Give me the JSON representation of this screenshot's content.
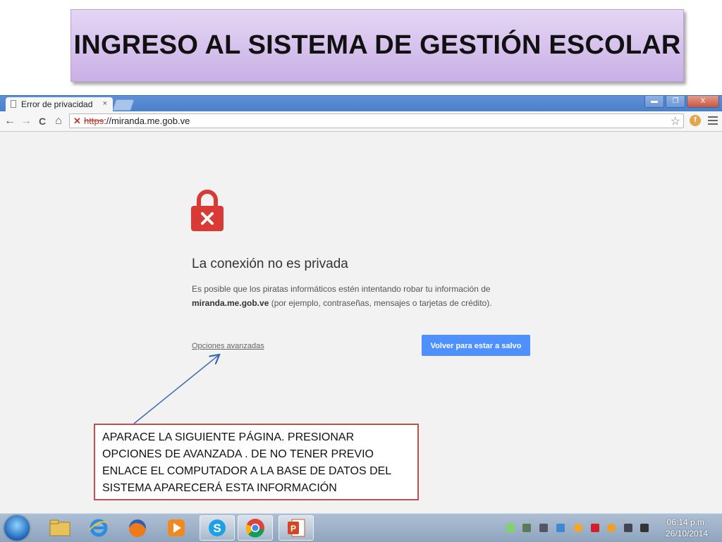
{
  "slide": {
    "title": "INGRESO AL SISTEMA DE GESTIÓN ESCOLAR"
  },
  "browser": {
    "tab_title": "Error de privacidad",
    "tab_close": "×",
    "window_buttons": {
      "minimize": "▬",
      "restore": "❐",
      "close": "X"
    },
    "url_scheme": "https",
    "url_rest": "://miranda.me.gob.ve",
    "nav": {
      "back": "←",
      "forward": "→",
      "reload": "C",
      "home": "⌂",
      "star": "☆"
    }
  },
  "error_page": {
    "heading": "La conexión no es privada",
    "desc_line1": "Es posible que los piratas informáticos estén intentando robar tu información de",
    "desc_domain": "miranda.me.gob.ve",
    "desc_line2_rest": " (por ejemplo, contraseñas, mensajes o tarjetas de crédito).",
    "advanced_link": "Opciones avanzadas",
    "back_button": "Volver para estar a salvo"
  },
  "callout": {
    "text": "APARACE  LA SIGUIENTE PÁGINA. PRESIONAR OPCIONES DE AVANZADA . DE NO TENER PREVIO ENLACE  EL COMPUTADOR A LA BASE DE DATOS DEL SISTEMA APARECERÁ ESTA INFORMACIÓN"
  },
  "taskbar": {
    "apps": [
      {
        "name": "explorer-icon"
      },
      {
        "name": "internet-explorer-icon"
      },
      {
        "name": "firefox-icon"
      },
      {
        "name": "media-player-icon"
      },
      {
        "name": "skype-icon"
      },
      {
        "name": "chrome-icon"
      },
      {
        "name": "powerpoint-icon"
      }
    ],
    "clock_time": "06:14 p.m.",
    "clock_date": "26/10/2014"
  },
  "colors": {
    "accent_blue": "#4d90fe",
    "error_red": "#d93a35",
    "callout_border": "#c0504d",
    "title_box": "#d9c6ef"
  }
}
